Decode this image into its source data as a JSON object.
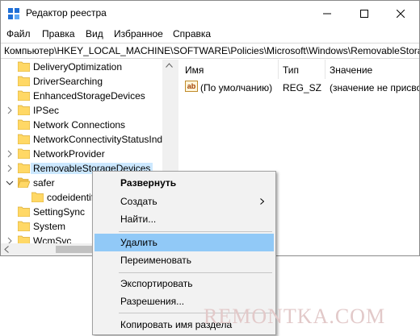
{
  "window": {
    "title": "Редактор реестра"
  },
  "menu": [
    "Файл",
    "Правка",
    "Вид",
    "Избранное",
    "Справка"
  ],
  "address": "Компьютер\\HKEY_LOCAL_MACHINE\\SOFTWARE\\Policies\\Microsoft\\Windows\\RemovableStorageDevices",
  "tree": [
    {
      "label": "DeliveryOptimization"
    },
    {
      "label": "DriverSearching"
    },
    {
      "label": "EnhancedStorageDevices"
    },
    {
      "label": "IPSec"
    },
    {
      "label": "Network Connections"
    },
    {
      "label": "NetworkConnectivityStatusIndicator"
    },
    {
      "label": "NetworkProvider"
    },
    {
      "label": "RemovableStorageDevices"
    },
    {
      "label": "safer"
    },
    {
      "label": "codeidentifiers"
    },
    {
      "label": "SettingSync"
    },
    {
      "label": "System"
    },
    {
      "label": "WcmSvc"
    }
  ],
  "columns": {
    "name": "Имя",
    "type": "Тип",
    "value": "Значение"
  },
  "value_row": {
    "icon_text": "ab",
    "name": "(По умолчанию)",
    "type": "REG_SZ",
    "value": "(значение не присвоено)"
  },
  "context_menu": {
    "expand": "Развернуть",
    "create": "Создать",
    "find": "Найти...",
    "delete": "Удалить",
    "rename": "Переименовать",
    "export": "Экспортировать",
    "permissions": "Разрешения...",
    "copy_key_name": "Копировать имя раздела"
  },
  "watermark": "REMONTKA.COM",
  "colors": {
    "selection": "#cce8ff",
    "menu_hover": "#91c9f7",
    "folder": "#ffd866",
    "chrome": "#f0f0f0"
  }
}
